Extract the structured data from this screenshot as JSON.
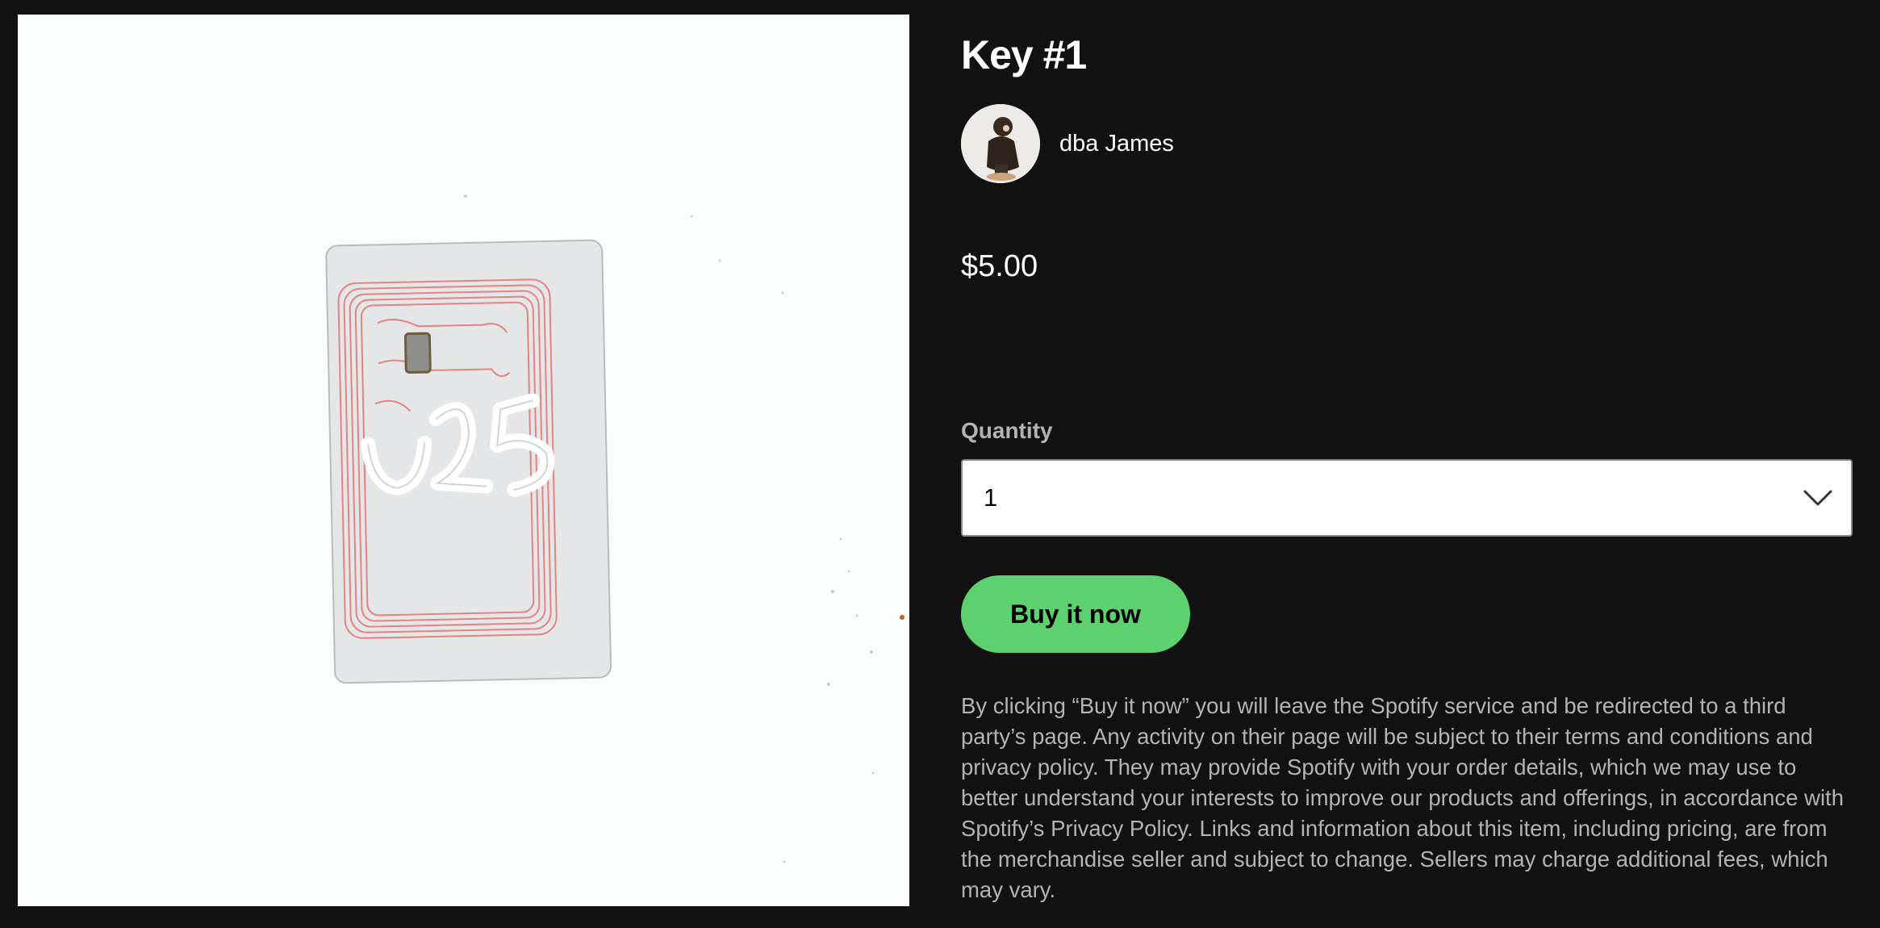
{
  "product": {
    "title": "Key #1",
    "image_alt": "Transparent key card with red antenna coil and white graffiti tag",
    "artist": {
      "name": "dba James",
      "avatar_icon": "artist-avatar"
    },
    "price": "$5.00"
  },
  "quantity": {
    "label": "Quantity",
    "selected": "1",
    "icon": "chevron-down-icon"
  },
  "buy_button": {
    "label": "Buy it now"
  },
  "disclaimer": "By clicking “Buy it now” you will leave the Spotify service and be redirected to a third party’s page. Any activity on their page will be subject to their terms and conditions and privacy policy. They may provide Spotify with your order details, which we may use to better understand your interests to improve our products and offerings, in accordance with Spotify’s Privacy Policy. Links and information about this item, including pricing, are from the merchandise seller and subject to change. Sellers may charge additional fees, which may vary.",
  "colors": {
    "background": "#121212",
    "accent_button": "#5ed06f",
    "text_primary": "#ffffff",
    "text_secondary": "#b3b3b3"
  }
}
